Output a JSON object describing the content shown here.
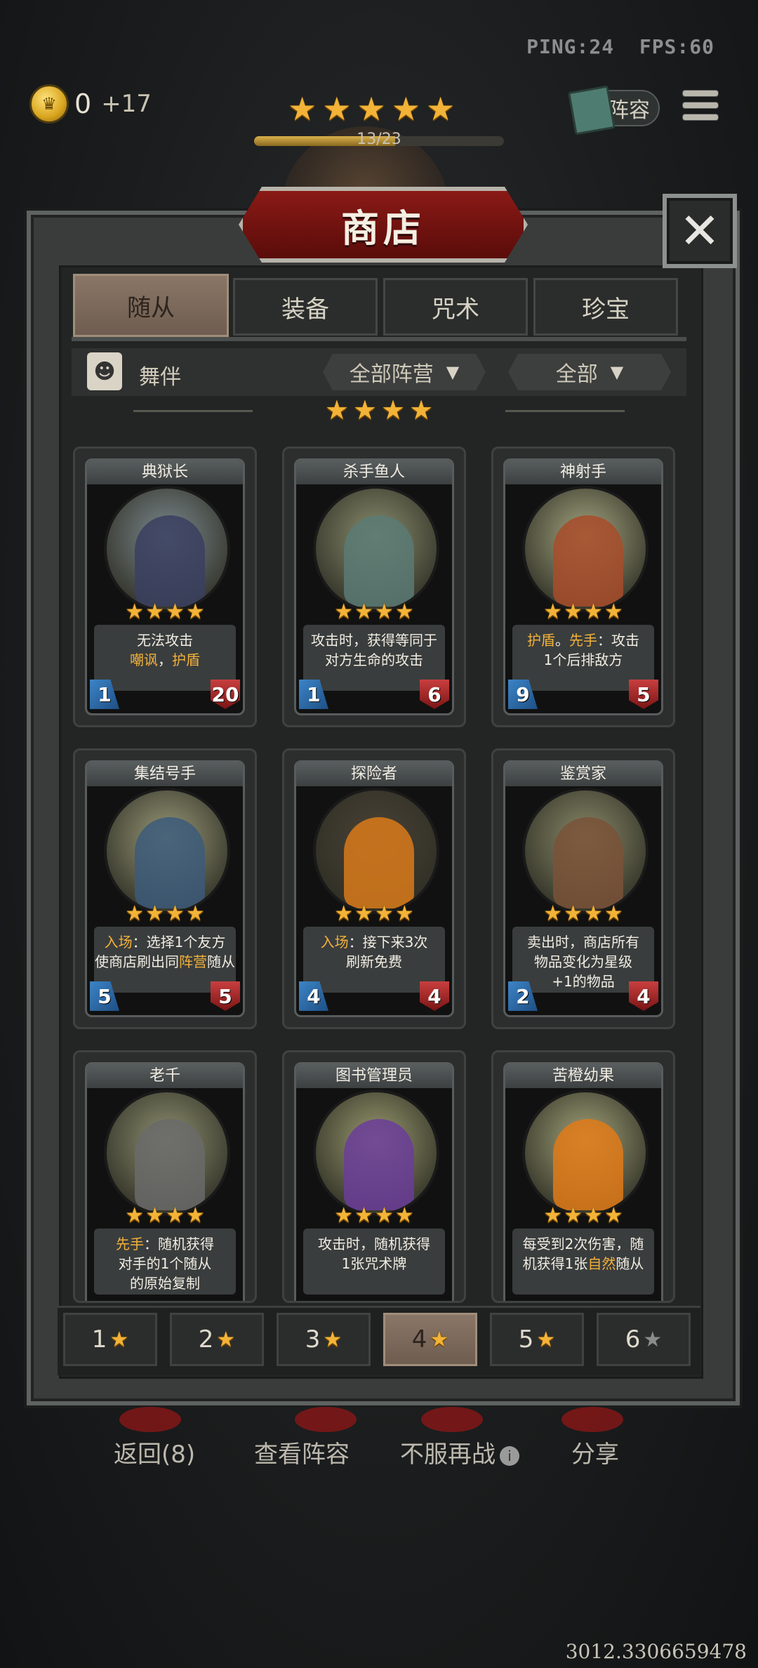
{
  "hud": {
    "ping": "PING:24",
    "fps": "FPS:60",
    "coins": "0",
    "coin_income": "+17",
    "stars": 5,
    "progress_text": "13/23",
    "progress_fraction": 0.565,
    "lineup_label": "阵容"
  },
  "shop": {
    "title": "商店",
    "close_label": "✕",
    "tabs": [
      "随从",
      "装备",
      "咒术",
      "珍宝"
    ],
    "active_tab": 0,
    "filter_label": "舞伴",
    "dropdown_faction": "全部阵营",
    "dropdown_all": "全部",
    "tier_stars": 4
  },
  "cards": [
    {
      "name": "典狱长",
      "desc_html": "无法攻击<br><span class=\"kw\">嘲讽</span>，<span class=\"kw\">护盾</span>",
      "attack": "1",
      "health": "20",
      "portrait_bg": "#7d8a8f",
      "figure": "#3a3f60"
    },
    {
      "name": "杀手鱼人",
      "desc_html": "攻击时，获得等同于<br>对方生命的攻击",
      "attack": "1",
      "health": "6",
      "portrait_bg": "#8a8e6e",
      "figure": "#5a7a74"
    },
    {
      "name": "神射手",
      "desc_html": "<span class=\"kw\">护盾</span>。<span class=\"kw\">先手</span>：攻击<br>1个后排敌方",
      "attack": "9",
      "health": "5",
      "portrait_bg": "#a5a680",
      "figure": "#a84c2a"
    },
    {
      "name": "集结号手",
      "desc_html": "<span class=\"kw\">入场</span>：选择1个友方<br>使商店刷出同<span class=\"kw\">阵营</span>随从",
      "attack": "5",
      "health": "5",
      "portrait_bg": "#9a9a7a",
      "figure": "#3c5b7a"
    },
    {
      "name": "探险者",
      "desc_html": "<span class=\"kw\">入场</span>：接下来3次<br>刷新免费",
      "attack": "4",
      "health": "4",
      "portrait_bg": "#4a4236",
      "figure": "#d97a1a"
    },
    {
      "name": "鉴赏家",
      "desc_html": "卖出时，商店所有<br>物品变化为星级<br>+1的物品",
      "attack": "2",
      "health": "4",
      "portrait_bg": "#8a8a6a",
      "figure": "#7a5238"
    },
    {
      "name": "老千",
      "desc_html": "<span class=\"kw\">先手</span>：随机获得<br>对手的1个随从<br>的原始复制",
      "attack": "",
      "health": "",
      "portrait_bg": "#8e9070",
      "figure": "#6a6a6a"
    },
    {
      "name": "图书管理员",
      "desc_html": "攻击时，随机获得<br>1张咒术牌",
      "attack": "",
      "health": "",
      "portrait_bg": "#9a9a70",
      "figure": "#6b3d9a"
    },
    {
      "name": "苦橙幼果",
      "desc_html": "每受到2次伤害，随<br>机获得1张<span class=\"kw\">自然</span>随从",
      "attack": "",
      "health": "",
      "portrait_bg": "#a3a37a",
      "figure": "#e07a18"
    }
  ],
  "tier_buttons": [
    {
      "label": "1",
      "active": false,
      "dim": false
    },
    {
      "label": "2",
      "active": false,
      "dim": false
    },
    {
      "label": "3",
      "active": false,
      "dim": false
    },
    {
      "label": "4",
      "active": true,
      "dim": false
    },
    {
      "label": "5",
      "active": false,
      "dim": false
    },
    {
      "label": "6",
      "active": false,
      "dim": true
    }
  ],
  "bottom_actions": {
    "back": "返回(8)",
    "view_lineup": "查看阵容",
    "rematch": "不服再战",
    "share": "分享"
  },
  "footer_text": "3012.3306659478"
}
